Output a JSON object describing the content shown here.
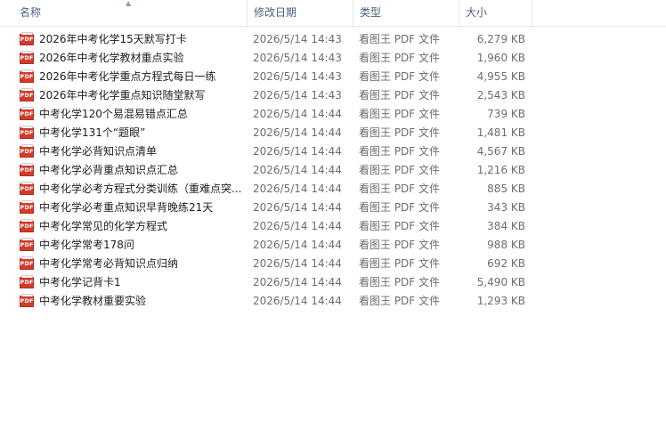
{
  "columns": {
    "name": "名称",
    "date": "修改日期",
    "type": "类型",
    "size": "大小"
  },
  "sort_indicator": "▲",
  "file_icon": "PDF",
  "files": [
    {
      "name": "2026年中考化学15天默写打卡",
      "date": "2026/5/14 14:43",
      "type": "看图王 PDF 文件",
      "size": "6,279 KB"
    },
    {
      "name": "2026年中考化学教材重点实验",
      "date": "2026/5/14 14:43",
      "type": "看图王 PDF 文件",
      "size": "1,960 KB"
    },
    {
      "name": "2026年中考化学重点方程式每日一练",
      "date": "2026/5/14 14:43",
      "type": "看图王 PDF 文件",
      "size": "4,955 KB"
    },
    {
      "name": "2026年中考化学重点知识随堂默写",
      "date": "2026/5/14 14:43",
      "type": "看图王 PDF 文件",
      "size": "2,543 KB"
    },
    {
      "name": "中考化学120个易混易错点汇总",
      "date": "2026/5/14 14:44",
      "type": "看图王 PDF 文件",
      "size": "739 KB"
    },
    {
      "name": "中考化学131个“题眼”",
      "date": "2026/5/14 14:44",
      "type": "看图王 PDF 文件",
      "size": "1,481 KB"
    },
    {
      "name": "中考化学必背知识点清单",
      "date": "2026/5/14 14:44",
      "type": "看图王 PDF 文件",
      "size": "4,567 KB"
    },
    {
      "name": "中考化学必背重点知识点汇总",
      "date": "2026/5/14 14:44",
      "type": "看图王 PDF 文件",
      "size": "1,216 KB"
    },
    {
      "name": "中考化学必考方程式分类训练（重难点突...",
      "date": "2026/5/14 14:44",
      "type": "看图王 PDF 文件",
      "size": "885 KB"
    },
    {
      "name": "中考化学必考重点知识早背晚练21天",
      "date": "2026/5/14 14:44",
      "type": "看图王 PDF 文件",
      "size": "343 KB"
    },
    {
      "name": "中考化学常见的化学方程式",
      "date": "2026/5/14 14:44",
      "type": "看图王 PDF 文件",
      "size": "384 KB"
    },
    {
      "name": "中考化学常考178问",
      "date": "2026/5/14 14:44",
      "type": "看图王 PDF 文件",
      "size": "988 KB"
    },
    {
      "name": "中考化学常考必背知识点归纳",
      "date": "2026/5/14 14:44",
      "type": "看图王 PDF 文件",
      "size": "692 KB"
    },
    {
      "name": "中考化学记背卡1",
      "date": "2026/5/14 14:44",
      "type": "看图王 PDF 文件",
      "size": "5,490 KB"
    },
    {
      "name": "中考化学教材重要实验",
      "date": "2026/5/14 14:44",
      "type": "看图王 PDF 文件",
      "size": "1,293 KB"
    }
  ]
}
